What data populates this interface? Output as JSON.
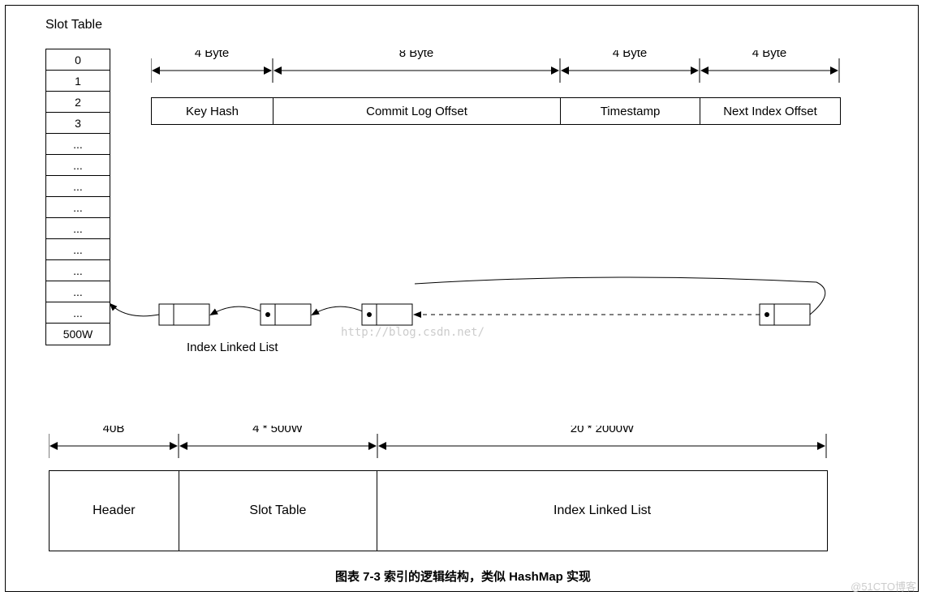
{
  "slot_table": {
    "title": "Slot Table",
    "rows": [
      "0",
      "1",
      "2",
      "3",
      "...",
      "...",
      "...",
      "...",
      "...",
      "...",
      "...",
      "...",
      "...",
      "500W"
    ]
  },
  "index_entry": {
    "sizes": [
      "4 Byte",
      "8 Byte",
      "4 Byte",
      "4 Byte"
    ],
    "fields": [
      "Key Hash",
      "Commit Log Offset",
      "Timestamp",
      "Next Index Offset"
    ],
    "widths": [
      150,
      354,
      172,
      172
    ]
  },
  "linked_list": {
    "label": "Index Linked List"
  },
  "file_layout": {
    "sizes": [
      "40B",
      "4 * 500W",
      "20 * 2000W"
    ],
    "sections": [
      "Header",
      "Slot Table",
      "Index Linked List"
    ],
    "widths": [
      160,
      245,
      555
    ]
  },
  "caption": "图表 7-3 索引的逻辑结构，类似 HashMap 实现",
  "watermark1": "http://blog.csdn.net/",
  "watermark2": "@51CTO博客"
}
